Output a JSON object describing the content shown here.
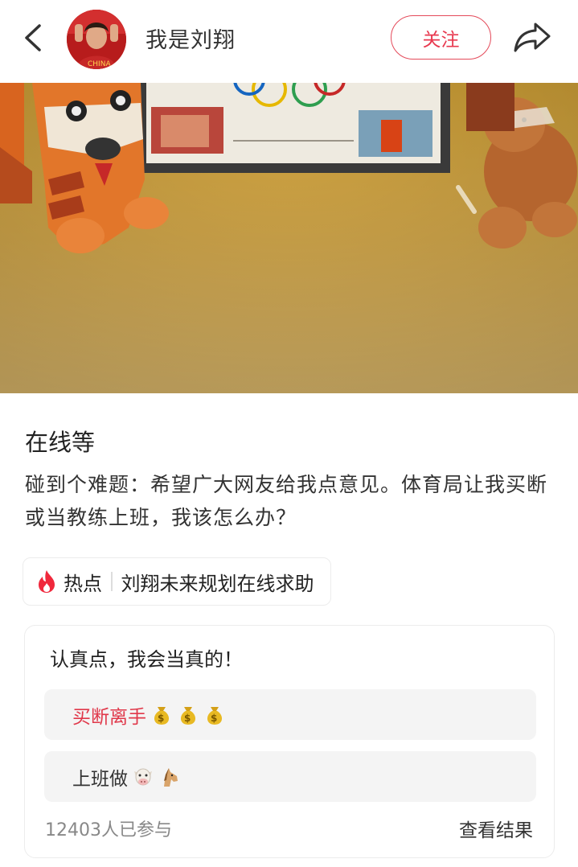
{
  "header": {
    "author_name": "我是刘翔",
    "follow_label": "关注"
  },
  "post": {
    "title": "在线等",
    "body": "碰到个难题：希望广大网友给我点意见。体育局让我买断或当教练上班，我该怎么办？"
  },
  "topic": {
    "hot_label": "热点",
    "name": "刘翔未来规划在线求助"
  },
  "poll": {
    "question": "认真点，我会当真的！",
    "options": [
      {
        "label": "买断离手",
        "emoji": [
          "money-bag-icon",
          "money-bag-icon",
          "money-bag-icon"
        ]
      },
      {
        "label": "上班做",
        "emoji": [
          "cow-icon",
          "horse-icon"
        ]
      }
    ],
    "participants": "12403人已参与",
    "result_label": "查看结果"
  },
  "colors": {
    "accent": "#e8394f",
    "carpet": "#c8a041",
    "option_bg": "#f4f4f4"
  }
}
